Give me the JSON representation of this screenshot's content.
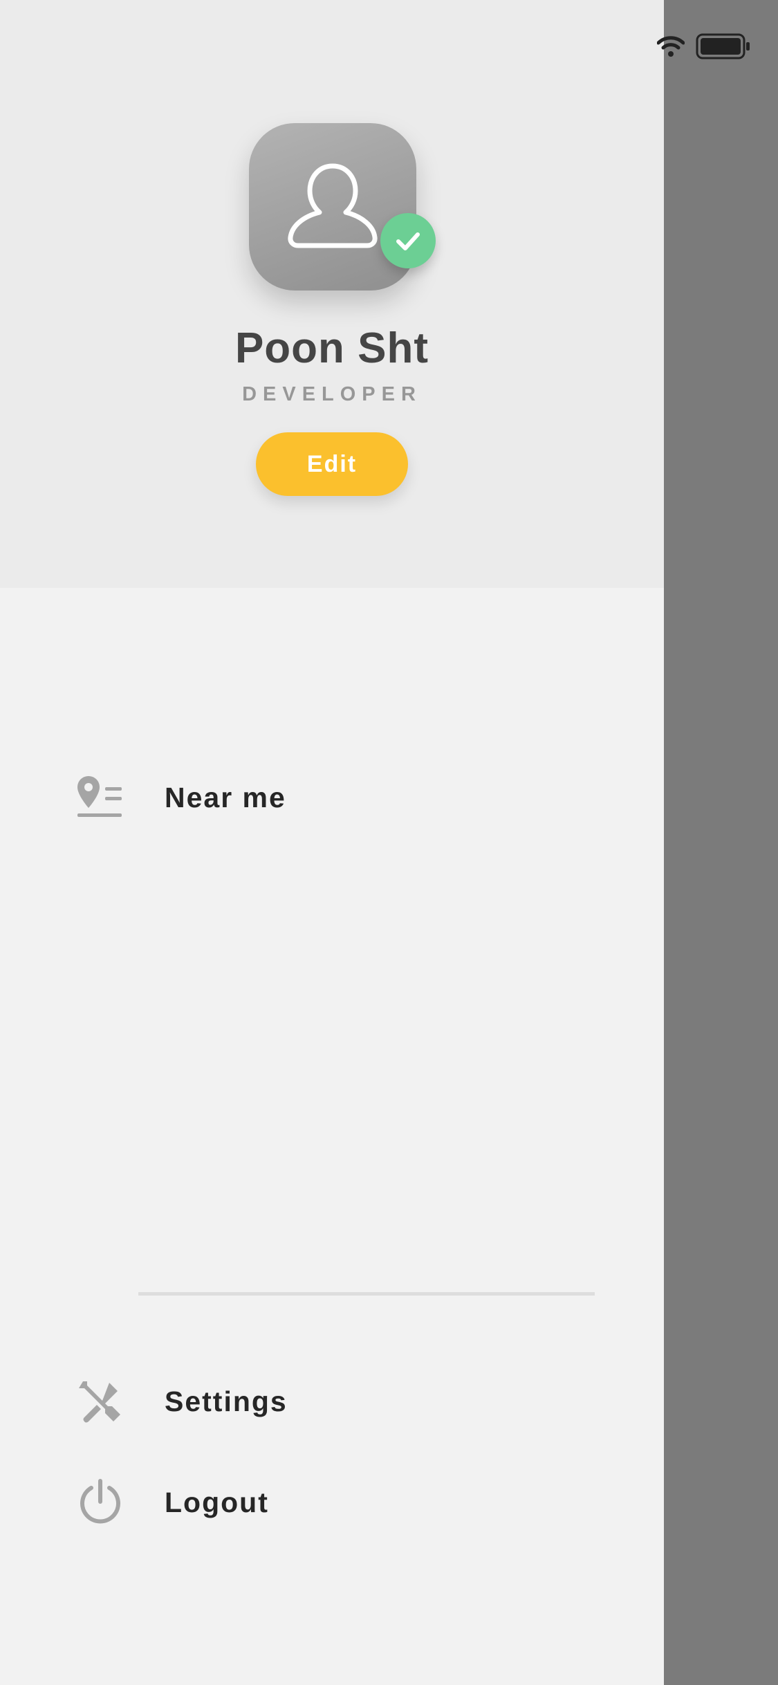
{
  "profile": {
    "name": "Poon Sht",
    "role": "DEVELOPER",
    "edit_label": "Edit",
    "verified_icon": "check-icon",
    "avatar_icon": "user-icon"
  },
  "menu": {
    "items": [
      {
        "label": "Near me",
        "icon": "location-list-icon"
      },
      {
        "label": "Settings",
        "icon": "tools-icon"
      },
      {
        "label": "Logout",
        "icon": "power-icon"
      }
    ]
  },
  "colors": {
    "accent": "#fbc02d",
    "verified": "#6ccf94",
    "overlay": "#7b7b7b"
  }
}
